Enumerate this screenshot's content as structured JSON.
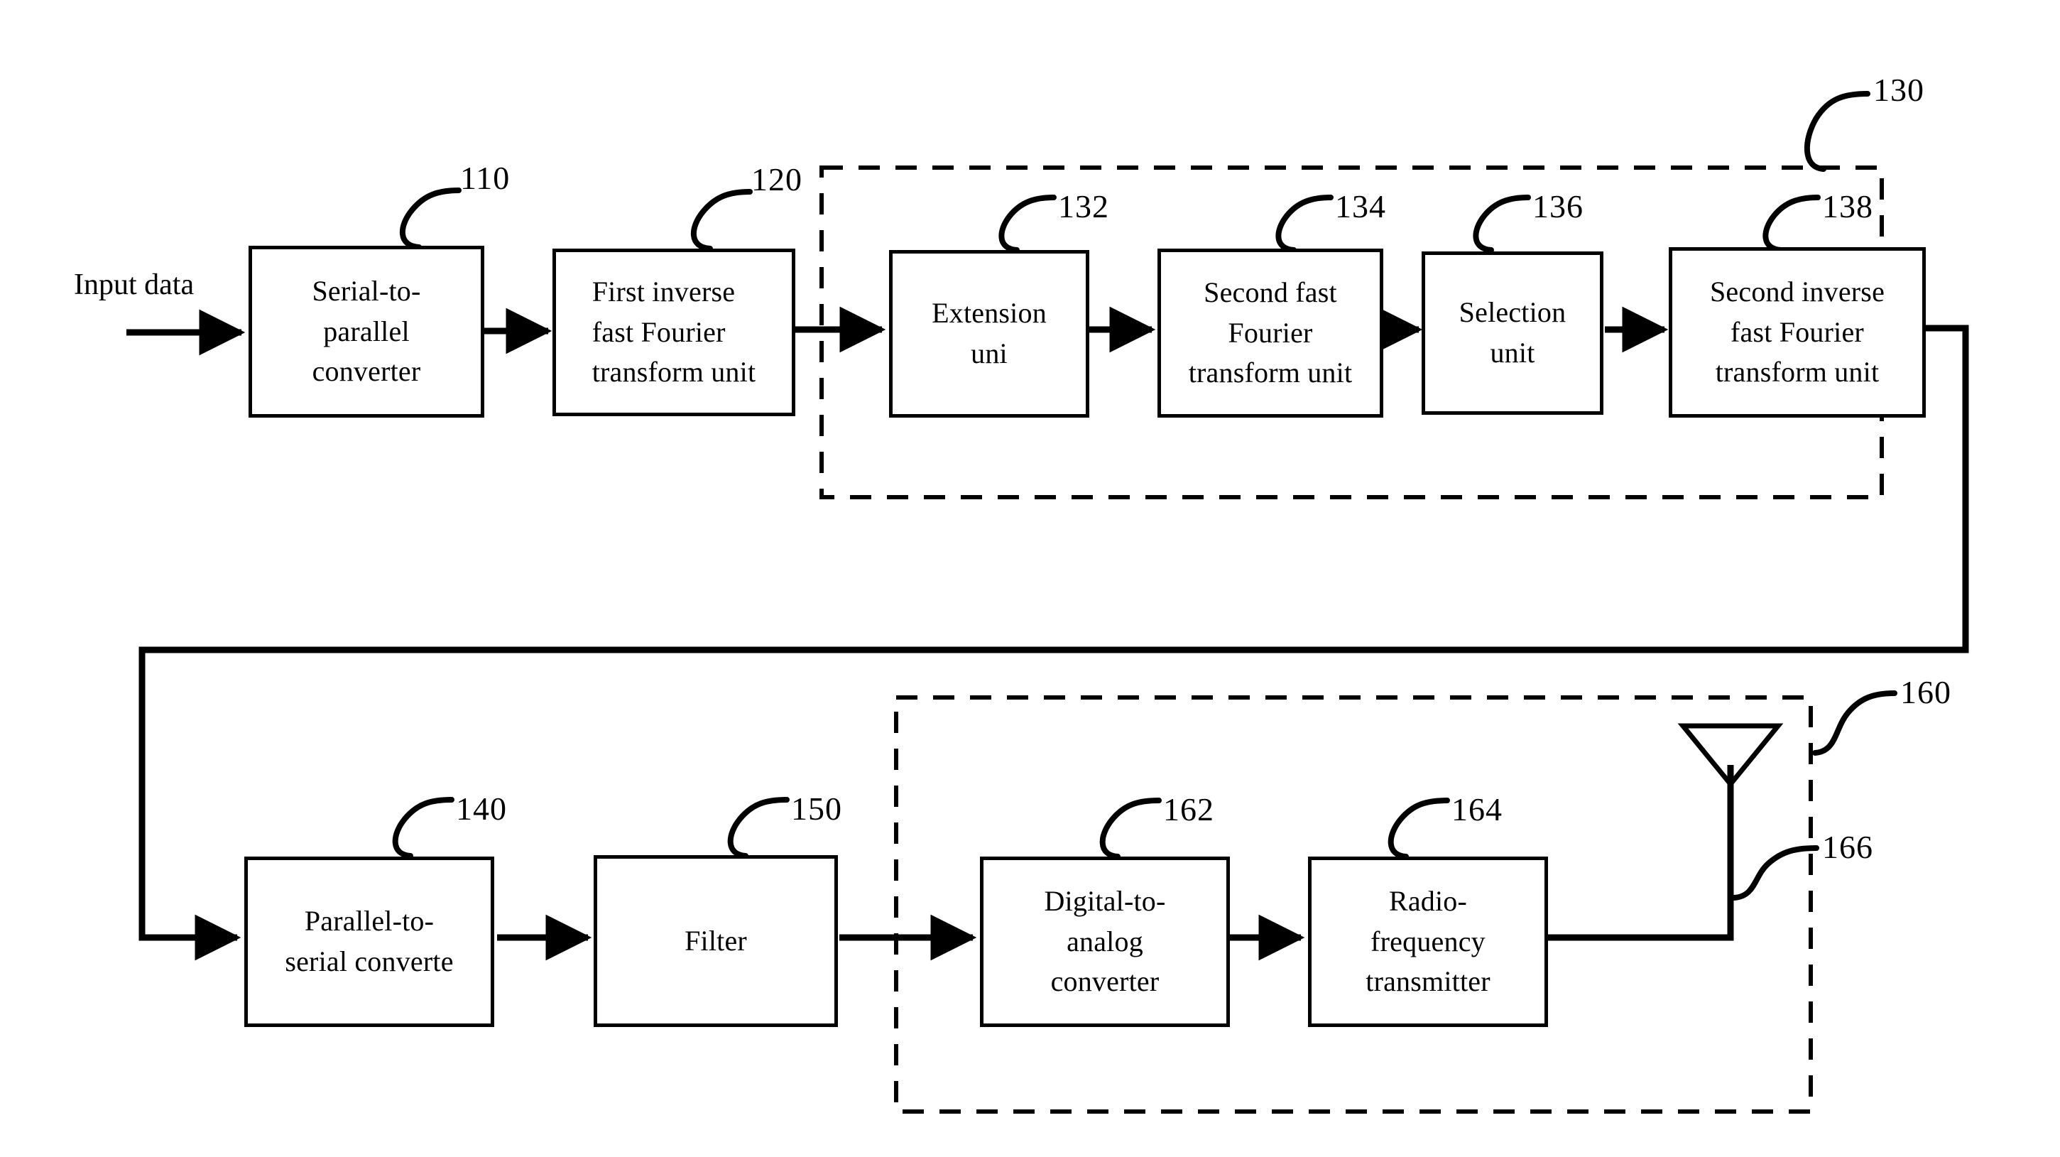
{
  "figure": {
    "type": "patent-block-diagram",
    "background": "#ffffff",
    "ink": "#000000"
  },
  "labels": {
    "input_data": "Input data"
  },
  "blocks": [
    {
      "id": "110",
      "label": "Serial-to-\nparallel\nconverter",
      "lines": [
        "Serial-to-",
        "parallel",
        "converter"
      ]
    },
    {
      "id": "120",
      "label": "First inverse fast Fourier transform unit",
      "lines": [
        "First inverse",
        "fast Fourier",
        "transform unit"
      ]
    },
    {
      "id": "132",
      "label": "Extension uni",
      "lines": [
        "Extension",
        "uni"
      ]
    },
    {
      "id": "134",
      "label": "Second fast Fourier transform unit",
      "lines": [
        "Second fast",
        "Fourier",
        "transform unit"
      ]
    },
    {
      "id": "136",
      "label": "Selection unit",
      "lines": [
        "Selection",
        "unit"
      ]
    },
    {
      "id": "138",
      "label": "Second inverse fast Fourier transform unit",
      "lines": [
        "Second inverse",
        "fast Fourier",
        "transform unit"
      ]
    },
    {
      "id": "140",
      "label": "Parallel-to-serial converte",
      "lines": [
        "Parallel-to-",
        "serial converte"
      ]
    },
    {
      "id": "150",
      "label": "Filter",
      "lines": [
        "Filter"
      ]
    },
    {
      "id": "162",
      "label": "Digital-to-analog converter",
      "lines": [
        "Digital-to-",
        "analog",
        "converter"
      ]
    },
    {
      "id": "164",
      "label": "Radio-frequency transmitter",
      "lines": [
        "Radio-",
        "frequency",
        "transmitter"
      ]
    }
  ],
  "groups": [
    {
      "id": "130",
      "label": "130",
      "style": "dashed"
    },
    {
      "id": "160",
      "label": "160",
      "style": "dashed"
    }
  ],
  "components": [
    {
      "id": "166",
      "label": "166",
      "kind": "antenna"
    }
  ],
  "reference_numerals": {
    "n110": "110",
    "n120": "120",
    "n130": "130",
    "n132": "132",
    "n134": "134",
    "n136": "136",
    "n138": "138",
    "n140": "140",
    "n150": "150",
    "n160": "160",
    "n162": "162",
    "n164": "164",
    "n166": "166"
  },
  "block_text": {
    "b110_l1": "Serial-to-",
    "b110_l2": "parallel",
    "b110_l3": "converter",
    "b120_l1": "First inverse",
    "b120_l2": "fast Fourier",
    "b120_l3": "transform unit",
    "b132_l1": "Extension",
    "b132_l2": "uni",
    "b134_l1": "Second fast",
    "b134_l2": "Fourier",
    "b134_l3": "transform unit",
    "b136_l1": "Selection",
    "b136_l2": "unit",
    "b138_l1": "Second inverse",
    "b138_l2": "fast Fourier",
    "b138_l3": "transform unit",
    "b140_l1": "Parallel-to-",
    "b140_l2": "serial converte",
    "b150_l1": "Filter",
    "b162_l1": "Digital-to-",
    "b162_l2": "analog",
    "b162_l3": "converter",
    "b164_l1": "Radio-",
    "b164_l2": "frequency",
    "b164_l3": "transmitter"
  }
}
